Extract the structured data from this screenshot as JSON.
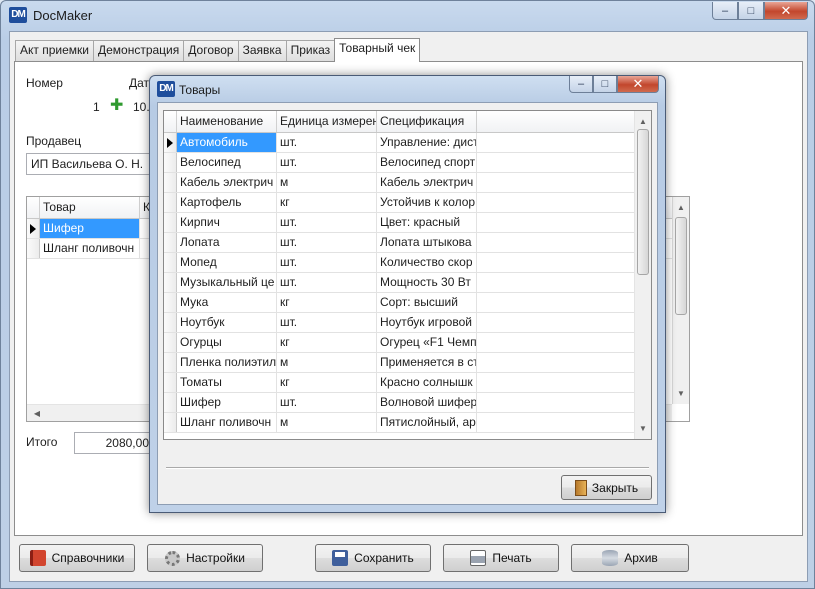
{
  "app": {
    "title": "DocMaker",
    "icon_text": "DM"
  },
  "window_buttons": {
    "minimize": "–",
    "maximize": "□",
    "close": "✕"
  },
  "tabs": [
    "Акт приемки",
    "Демонстрация",
    "Договор",
    "Заявка",
    "Приказ",
    "Товарный чек"
  ],
  "active_tab": "Товарный чек",
  "receipt": {
    "number_label": "Номер",
    "number_value": "1",
    "date_label": "Дат",
    "date_value": "10.",
    "seller_label": "Продавец",
    "seller_value": "ИП Васильева О. Н.",
    "items_columns": [
      "Товар",
      "К"
    ],
    "items_rows": [
      "Шифер",
      "Шланг поливочн"
    ],
    "total_label": "Итого",
    "total_value": "2080,00"
  },
  "bottom_buttons": {
    "references": "Справочники",
    "settings": "Настройки",
    "save": "Сохранить",
    "print": "Печать",
    "archive": "Архив"
  },
  "dialog": {
    "title": "Товары",
    "icon_text": "DM",
    "columns": [
      "Наименование",
      "Единица измерен",
      "Спецификация"
    ],
    "rows": [
      [
        "Автомобиль",
        "шт.",
        "Управление: дист"
      ],
      [
        "Велосипед",
        "шт.",
        "Велосипед спорт"
      ],
      [
        "Кабель электрич",
        "м",
        "Кабель электрич"
      ],
      [
        "Картофель",
        "кг",
        "Устойчив к колор"
      ],
      [
        "Кирпич",
        "шт.",
        "Цвет: красный"
      ],
      [
        "Лопата",
        "шт.",
        "Лопата штыкова"
      ],
      [
        "Мопед",
        "шт.",
        "Количество скор"
      ],
      [
        "Музыкальный це",
        "шт.",
        "Мощность 30 Вт"
      ],
      [
        "Мука",
        "кг",
        "Сорт: высший"
      ],
      [
        "Ноутбук",
        "шт.",
        "Ноутбук игровой"
      ],
      [
        "Огурцы",
        "кг",
        "Огурец «F1 Чемп"
      ],
      [
        "Пленка полиэтил",
        "м",
        "Применяется в ст"
      ],
      [
        "Томаты",
        "кг",
        "Красно солнышк"
      ],
      [
        "Шифер",
        "шт.",
        "Волновой шифер"
      ],
      [
        "Шланг поливочн",
        "м",
        "Пятислойный, ар"
      ]
    ],
    "close_button": "Закрыть"
  },
  "icons": {
    "app": "dm-logo-icon",
    "add": "plus-icon",
    "references": "book-icon",
    "settings": "gear-icon",
    "save": "floppy-disk-icon",
    "print": "printer-icon",
    "archive": "database-icon",
    "close_dialog": "door-icon"
  },
  "colors": {
    "selection": "#3399ff",
    "close_caption": "#c2462c",
    "add_icon": "#2f9a2f"
  }
}
